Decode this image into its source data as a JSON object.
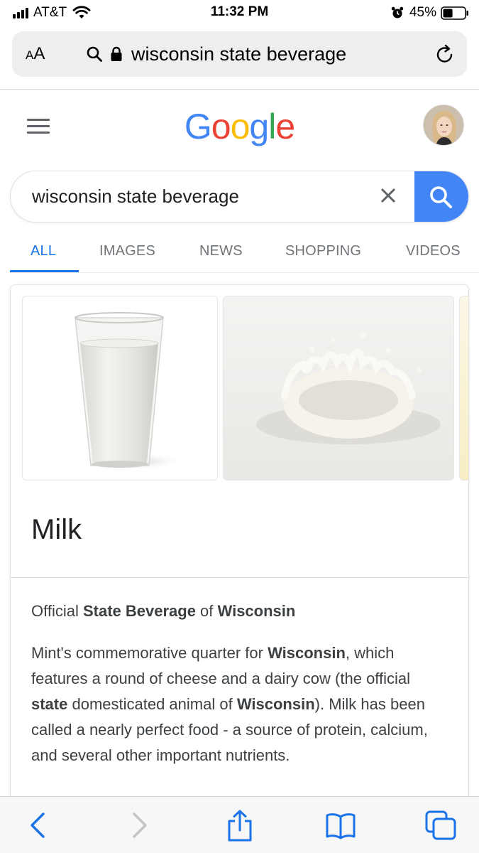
{
  "status_bar": {
    "carrier": "AT&T",
    "time": "11:32 PM",
    "battery_percent": "45%",
    "battery_level": 0.45,
    "icons": [
      "signal-icon",
      "wifi-icon",
      "alarm-icon",
      "battery-icon"
    ]
  },
  "safari": {
    "text_size_label": "AA",
    "url_text": "wisconsin state beverage",
    "icons": [
      "search-icon",
      "lock-icon",
      "reload-icon"
    ]
  },
  "google": {
    "logo_letters": [
      {
        "char": "G",
        "color": "#4285f4"
      },
      {
        "char": "o",
        "color": "#ea4335"
      },
      {
        "char": "o",
        "color": "#fbbc05"
      },
      {
        "char": "g",
        "color": "#4285f4"
      },
      {
        "char": "l",
        "color": "#34a853"
      },
      {
        "char": "e",
        "color": "#ea4335"
      }
    ],
    "search_value": "wisconsin state beverage",
    "search_button_color": "#4285f4"
  },
  "tabs": [
    {
      "label": "ALL",
      "active": true
    },
    {
      "label": "IMAGES",
      "active": false
    },
    {
      "label": "NEWS",
      "active": false
    },
    {
      "label": "SHOPPING",
      "active": false
    },
    {
      "label": "VIDEOS",
      "active": false
    }
  ],
  "panel": {
    "title": "Milk",
    "subtitle": {
      "part1": "Official ",
      "bold1": "State Beverage",
      "part2": " of ",
      "bold2": "Wisconsin"
    },
    "description": {
      "t1": "Mint's commemorative quarter for ",
      "b1": "Wisconsin",
      "t2": ", which features a round of cheese and a dairy cow (the official ",
      "b2": "state",
      "t3": " domesticated animal of ",
      "b3": "Wisconsin",
      "t4": "). Milk has been called a nearly perfect food - a source of protein, calcium, and several other important nutrients."
    }
  },
  "toolbar": {
    "icons": [
      "back-icon",
      "forward-icon",
      "share-icon",
      "bookmarks-icon",
      "tabs-icon"
    ],
    "accent_color": "#1a73e8"
  },
  "colors": {
    "link_blue": "#1a73e8",
    "text_gray": "#70757a"
  }
}
